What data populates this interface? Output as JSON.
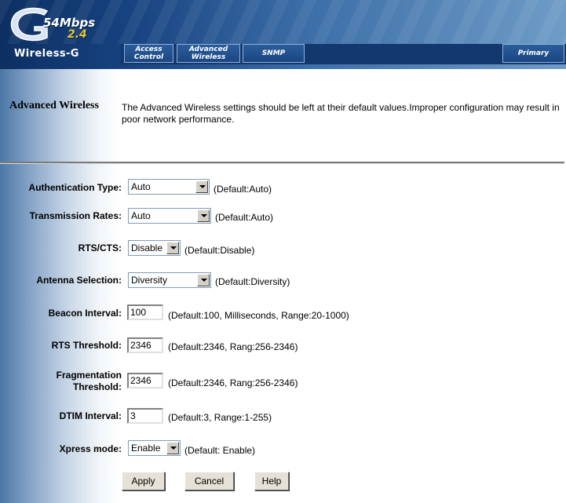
{
  "brand": {
    "speed": "54Mbps",
    "band": "2.4",
    "name": "Wireless-G"
  },
  "nav": {
    "tabs": [
      {
        "line1": "Access",
        "line2": "Control"
      },
      {
        "line1": "Advanced",
        "line2": "Wireless"
      },
      {
        "line1": "SNMP",
        "line2": ""
      },
      {
        "line1": "Primary",
        "line2": ""
      }
    ]
  },
  "section": {
    "title": "Advanced Wireless",
    "description": "The Advanced Wireless settings should be left at their default values.Improper configuration may result in poor network performance."
  },
  "form": {
    "auth_type": {
      "label": "Authentication Type:",
      "value": "Auto",
      "hint": "(Default:Auto)"
    },
    "tx_rates": {
      "label": "Transmission Rates:",
      "value": "Auto",
      "hint": "(Default:Auto)"
    },
    "rts_cts": {
      "label": "RTS/CTS:",
      "value": "Disable",
      "hint": "(Default:Disable)"
    },
    "antenna": {
      "label": "Antenna Selection:",
      "value": "Diversity",
      "hint": "(Default:Diversity)"
    },
    "beacon": {
      "label": "Beacon Interval:",
      "value": "100",
      "hint": "(Default:100, Milliseconds, Range:20-1000)"
    },
    "rts_threshold": {
      "label": "RTS Threshold:",
      "value": "2346",
      "hint": "(Default:2346, Rang:256-2346)"
    },
    "frag_threshold": {
      "label_line1": "Fragmentation",
      "label_line2": "Threshold:",
      "value": "2346",
      "hint": "(Default:2346, Rang:256-2346)"
    },
    "dtim": {
      "label": "DTIM Interval:",
      "value": "3",
      "hint": "(Default:3, Range:1-255)"
    },
    "xpress": {
      "label": "Xpress mode:",
      "value": "Enable",
      "hint": "(Default: Enable)"
    }
  },
  "buttons": {
    "apply": "Apply",
    "cancel": "Cancel",
    "help": "Help"
  },
  "colors": {
    "header_dark": "#0d2f63",
    "header_light": "#6f9cc7",
    "logo_accent": "#e0c73a"
  }
}
